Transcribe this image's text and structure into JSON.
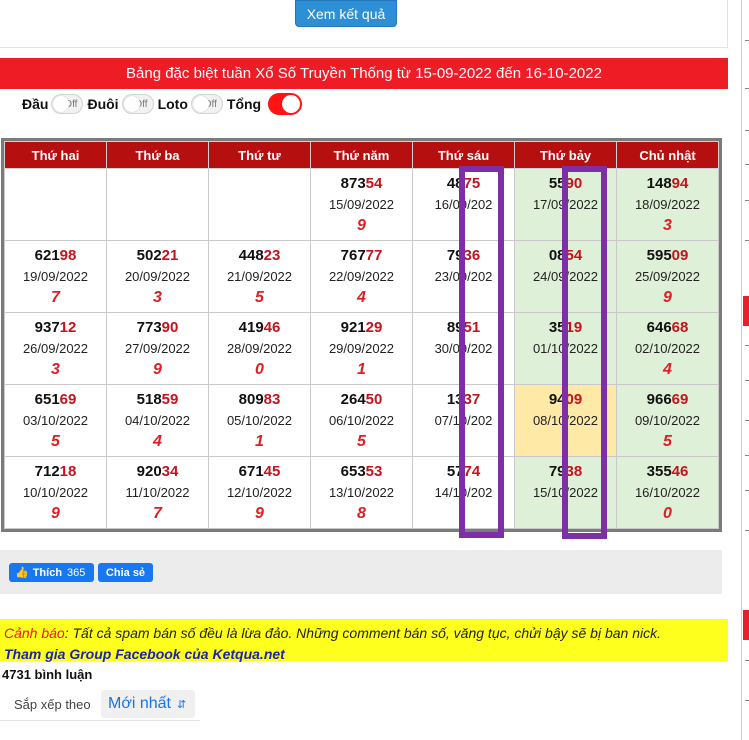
{
  "result_button": "Xem kết quả",
  "title": "Bảng đặc biệt tuần Xổ Số Truyền Thống từ 15-09-2022 đến 16-10-2022",
  "toggles": {
    "dau": "Đầu",
    "duoi": "Đuôi",
    "loto": "Loto",
    "tong": "Tổng",
    "off": "Off"
  },
  "table": {
    "headers": [
      "Thứ hai",
      "Thứ ba",
      "Thứ tư",
      "Thứ năm",
      "Thứ sáu",
      "Thứ bảy",
      "Chủ nhật"
    ],
    "rows": [
      [
        {
          "head": "",
          "tail": "",
          "date": "",
          "sum": ""
        },
        {
          "head": "",
          "tail": "",
          "date": "",
          "sum": ""
        },
        {
          "head": "",
          "tail": "",
          "date": "",
          "sum": ""
        },
        {
          "head": "873",
          "tail": "54",
          "date": "15/09/2022",
          "sum": "9"
        },
        {
          "head": "48",
          "tail": "75",
          "date": "16/09/202",
          "sum": ""
        },
        {
          "head": "55",
          "tail": "90",
          "date": "17/09/2022",
          "sum": ""
        },
        {
          "head": "148",
          "tail": "94",
          "date": "18/09/2022",
          "sum": "3"
        }
      ],
      [
        {
          "head": "621",
          "tail": "98",
          "date": "19/09/2022",
          "sum": "7"
        },
        {
          "head": "502",
          "tail": "21",
          "date": "20/09/2022",
          "sum": "3"
        },
        {
          "head": "448",
          "tail": "23",
          "date": "21/09/2022",
          "sum": "5"
        },
        {
          "head": "767",
          "tail": "77",
          "date": "22/09/2022",
          "sum": "4"
        },
        {
          "head": "79",
          "tail": "36",
          "date": "23/09/202",
          "sum": ""
        },
        {
          "head": "08",
          "tail": "54",
          "date": "24/09/2022",
          "sum": ""
        },
        {
          "head": "595",
          "tail": "09",
          "date": "25/09/2022",
          "sum": "9"
        }
      ],
      [
        {
          "head": "937",
          "tail": "12",
          "date": "26/09/2022",
          "sum": "3"
        },
        {
          "head": "773",
          "tail": "90",
          "date": "27/09/2022",
          "sum": "9"
        },
        {
          "head": "419",
          "tail": "46",
          "date": "28/09/2022",
          "sum": "0"
        },
        {
          "head": "921",
          "tail": "29",
          "date": "29/09/2022",
          "sum": "1"
        },
        {
          "head": "89",
          "tail": "51",
          "date": "30/09/202",
          "sum": ""
        },
        {
          "head": "35",
          "tail": "19",
          "date": "01/10/2022",
          "sum": ""
        },
        {
          "head": "646",
          "tail": "68",
          "date": "02/10/2022",
          "sum": "4"
        }
      ],
      [
        {
          "head": "651",
          "tail": "69",
          "date": "03/10/2022",
          "sum": "5"
        },
        {
          "head": "518",
          "tail": "59",
          "date": "04/10/2022",
          "sum": "4"
        },
        {
          "head": "809",
          "tail": "83",
          "date": "05/10/2022",
          "sum": "1"
        },
        {
          "head": "264",
          "tail": "50",
          "date": "06/10/2022",
          "sum": "5"
        },
        {
          "head": "13",
          "tail": "37",
          "date": "07/10/202",
          "sum": ""
        },
        {
          "head": "94",
          "tail": "09",
          "date": "08/10/2022",
          "sum": ""
        },
        {
          "head": "966",
          "tail": "69",
          "date": "09/10/2022",
          "sum": "5"
        }
      ],
      [
        {
          "head": "712",
          "tail": "18",
          "date": "10/10/2022",
          "sum": "9"
        },
        {
          "head": "920",
          "tail": "34",
          "date": "11/10/2022",
          "sum": "7"
        },
        {
          "head": "671",
          "tail": "45",
          "date": "12/10/2022",
          "sum": "9"
        },
        {
          "head": "653",
          "tail": "53",
          "date": "13/10/2022",
          "sum": "8"
        },
        {
          "head": "57",
          "tail": "74",
          "date": "14/10/202",
          "sum": ""
        },
        {
          "head": "79",
          "tail": "38",
          "date": "15/10/2022",
          "sum": ""
        },
        {
          "head": "355",
          "tail": "46",
          "date": "16/10/2022",
          "sum": "0"
        }
      ]
    ]
  },
  "social": {
    "like": "Thích",
    "like_count": "365",
    "share": "Chia sẻ"
  },
  "warning": {
    "label": "Cảnh báo",
    "text": ": Tất cả spam bán số đều là lừa đảo. Những comment bán số, văng tục, chửi bậy sẽ bị ban nick.",
    "link": "Tham gia Group Facebook của Ketqua.net"
  },
  "comments": {
    "count": "4731 bình luận",
    "sort_label": "Sắp xếp theo",
    "sort_value": "Mới nhất"
  },
  "colors": {
    "red": "#ee1c25",
    "header": "#b50f0f",
    "green": "#dff0d8",
    "yellow": "#ffe9a6",
    "highlight": "#7e2fa8"
  }
}
